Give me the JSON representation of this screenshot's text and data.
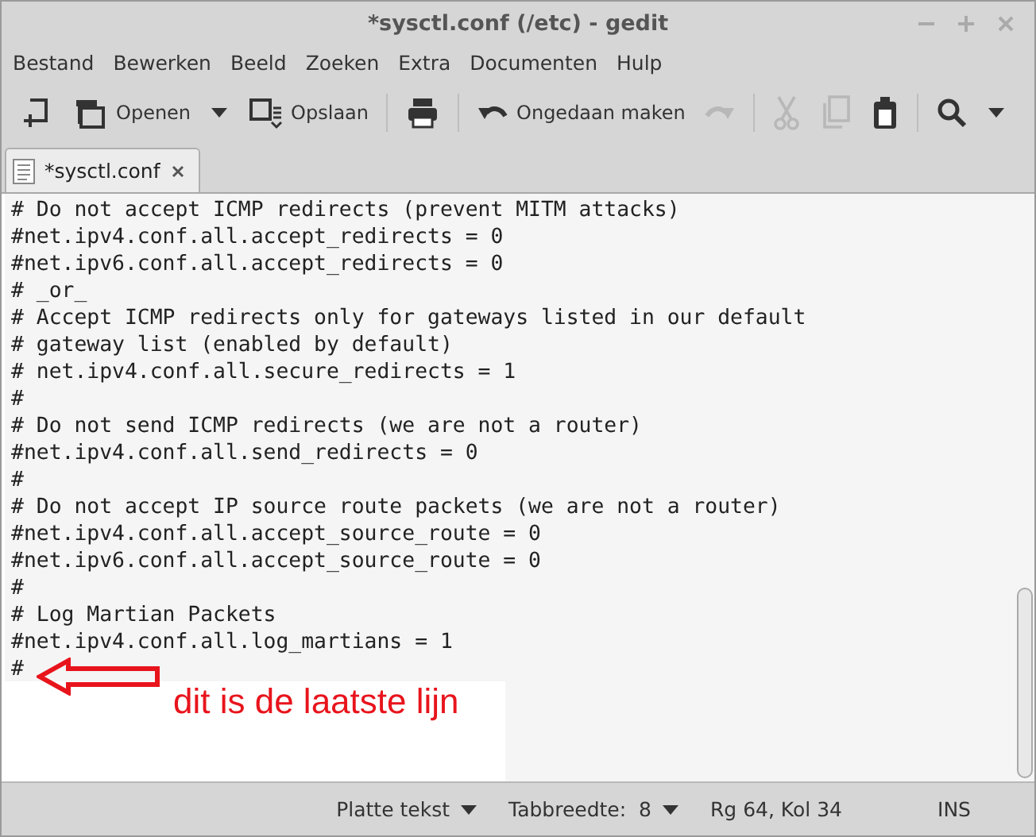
{
  "window": {
    "title": "*sysctl.conf (/etc) - gedit"
  },
  "menu": [
    "Bestand",
    "Bewerken",
    "Beeld",
    "Zoeken",
    "Extra",
    "Documenten",
    "Hulp"
  ],
  "toolbar": [
    {
      "kind": "new",
      "disabled": false
    },
    {
      "kind": "open",
      "label": "Openen",
      "disabled": false
    },
    {
      "kind": "menu",
      "disabled": false
    },
    {
      "kind": "save",
      "label": "Opslaan",
      "disabled": false
    },
    {
      "kind": "sep"
    },
    {
      "kind": "print",
      "disabled": false
    },
    {
      "kind": "sep"
    },
    {
      "kind": "undo",
      "label": "Ongedaan maken",
      "disabled": false
    },
    {
      "kind": "redo",
      "disabled": true
    },
    {
      "kind": "sep"
    },
    {
      "kind": "cut",
      "disabled": true
    },
    {
      "kind": "copy",
      "disabled": true
    },
    {
      "kind": "paste",
      "disabled": false
    },
    {
      "kind": "sep"
    },
    {
      "kind": "search",
      "disabled": false
    },
    {
      "kind": "menu",
      "disabled": false
    }
  ],
  "tabs": [
    {
      "label": "*sysctl.conf",
      "selected": true
    }
  ],
  "lines": [
    "# Do not accept ICMP redirects (prevent MITM attacks)",
    "#net.ipv4.conf.all.accept_redirects = 0",
    "#net.ipv6.conf.all.accept_redirects = 0",
    "# _or_",
    "# Accept ICMP redirects only for gateways listed in our default",
    "# gateway list (enabled by default)",
    "# net.ipv4.conf.all.secure_redirects = 1",
    "#",
    "# Do not send ICMP redirects (we are not a router)",
    "#net.ipv4.conf.all.send_redirects = 0",
    "#",
    "# Do not accept IP source route packets (we are not a router)",
    "#net.ipv4.conf.all.accept_source_route = 0",
    "#net.ipv6.conf.all.accept_source_route = 0",
    "#",
    "# Log Martian Packets",
    "#net.ipv4.conf.all.log_martians = 1",
    "#"
  ],
  "annotation": {
    "text": "dit is de laatste lijn"
  },
  "status_bar": [
    {
      "label": "Platte tekst",
      "dropdown": true
    },
    {
      "label": "Tabbreedte:  8",
      "dropdown": true
    },
    {
      "label": "Rg 64, Kol 34",
      "dropdown": false
    },
    {
      "label": "INS",
      "dropdown": false
    }
  ]
}
